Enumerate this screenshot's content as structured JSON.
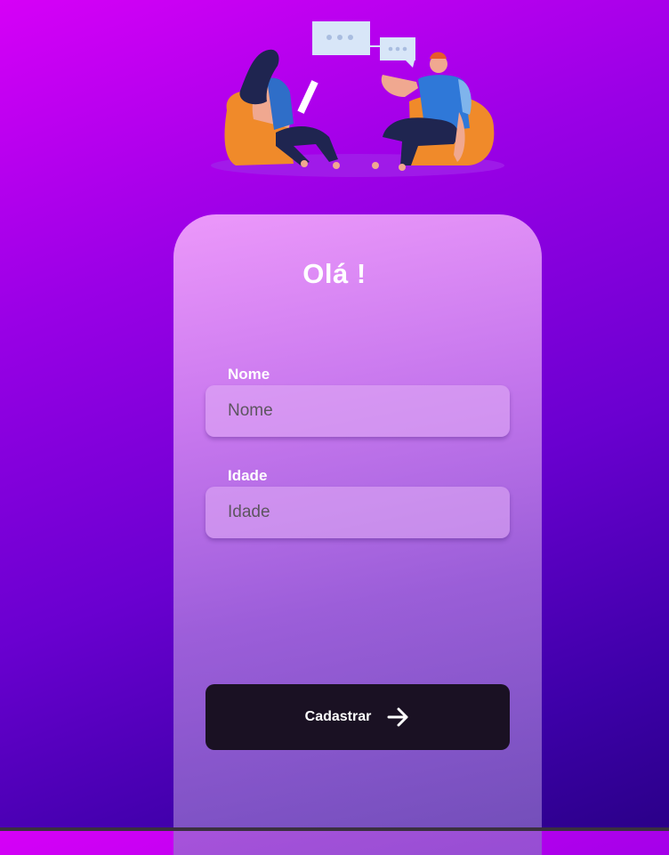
{
  "greeting": "Olá !",
  "form": {
    "name_label": "Nome",
    "name_placeholder": "Nome",
    "age_label": "Idade",
    "age_placeholder": "Idade"
  },
  "submit": {
    "label": "Cadastrar",
    "icon": "arrow-right-icon"
  },
  "illustration": "two-people-chatting-illustration",
  "colors": {
    "background_top": "#d600f7",
    "background_bottom": "#2a0088",
    "button": "#1a1123",
    "text": "#ffffff"
  }
}
